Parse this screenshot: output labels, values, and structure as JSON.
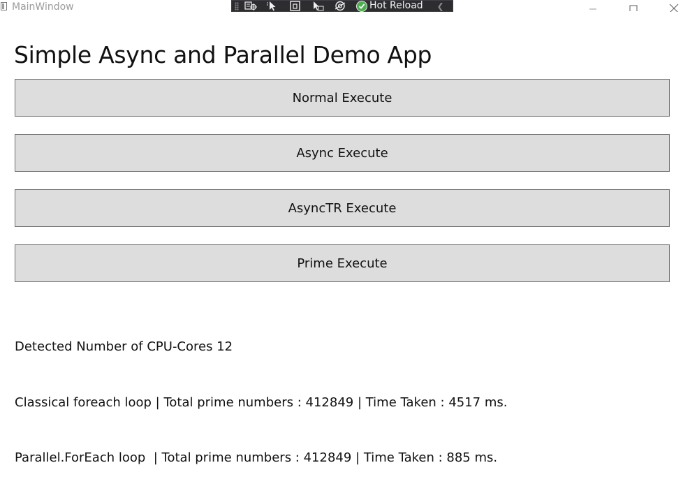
{
  "window": {
    "title": "MainWindow"
  },
  "debug_toolbar": {
    "hot_reload_label": "Hot Reload"
  },
  "main": {
    "heading": "Simple Async and Parallel Demo App",
    "buttons": [
      "Normal Execute",
      "Async Execute",
      "AsyncTR Execute",
      "Prime Execute"
    ],
    "output_lines": [
      "Detected Number of CPU-Cores 12",
      "Classical foreach loop | Total prime numbers : 412849 | Time Taken : 4517 ms.",
      "Parallel.ForEach loop  | Total prime numbers : 412849 | Time Taken : 885 ms."
    ]
  },
  "colors": {
    "button_bg": "#dddddd",
    "button_border": "#707070",
    "toolbar_bg": "#2d2d30",
    "hot_reload_green": "#4caf50"
  },
  "icons": {
    "minimize": "minimize-icon",
    "maximize": "maximize-icon",
    "close": "close-icon",
    "hot_reload": "checkmark-circle-icon"
  }
}
